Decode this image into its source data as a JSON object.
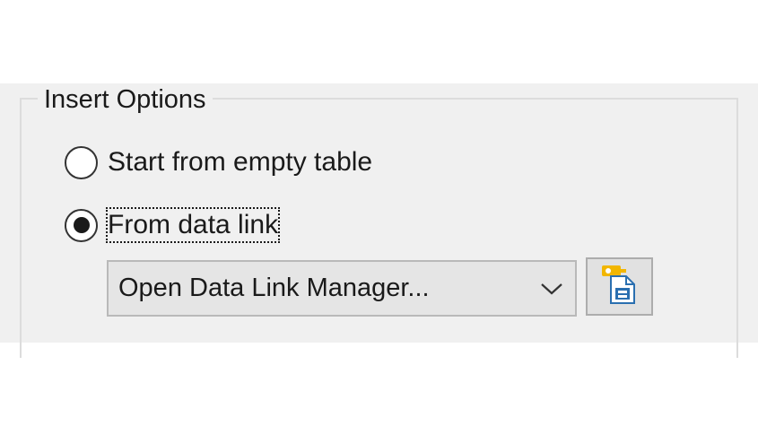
{
  "group": {
    "title": "Insert Options"
  },
  "options": [
    {
      "label": "Start from empty table",
      "selected": false
    },
    {
      "label": "From data link",
      "selected": true
    }
  ],
  "data_link": {
    "selected": "Open Data Link Manager..."
  },
  "icons": {
    "dropdown": "chevron-down-icon",
    "manager": "data-link-manager-icon"
  },
  "colors": {
    "panel": "#f0f0f0",
    "group_border": "#dcdcdc",
    "text": "#1a1a1a",
    "combo_bg": "#e5e5e5",
    "button_bg": "#e1e1e1",
    "icon_accent": "#f2b600",
    "icon_blue": "#2a6fb0"
  }
}
